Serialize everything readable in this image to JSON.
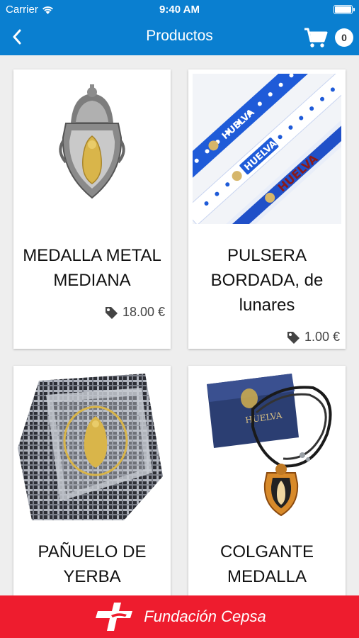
{
  "status_bar": {
    "carrier": "Carrier",
    "time": "9:40 AM"
  },
  "nav": {
    "title": "Productos",
    "cart_count": "0"
  },
  "products": [
    {
      "name": "MEDALLA METAL MEDIANA",
      "price": "18.00 €"
    },
    {
      "name": "PULSERA BORDADA, de lunares",
      "price": "1.00 €"
    },
    {
      "name": "PAÑUELO DE YERBA"
    },
    {
      "name": "COLGANTE MEDALLA"
    }
  ],
  "footer": {
    "brand": "Fundación Cepsa"
  },
  "images": {
    "bracelet_text": "HUELVA",
    "box_text": "HUELVA"
  },
  "colors": {
    "primary": "#0a7fd0",
    "footer": "#ee1c2e"
  }
}
